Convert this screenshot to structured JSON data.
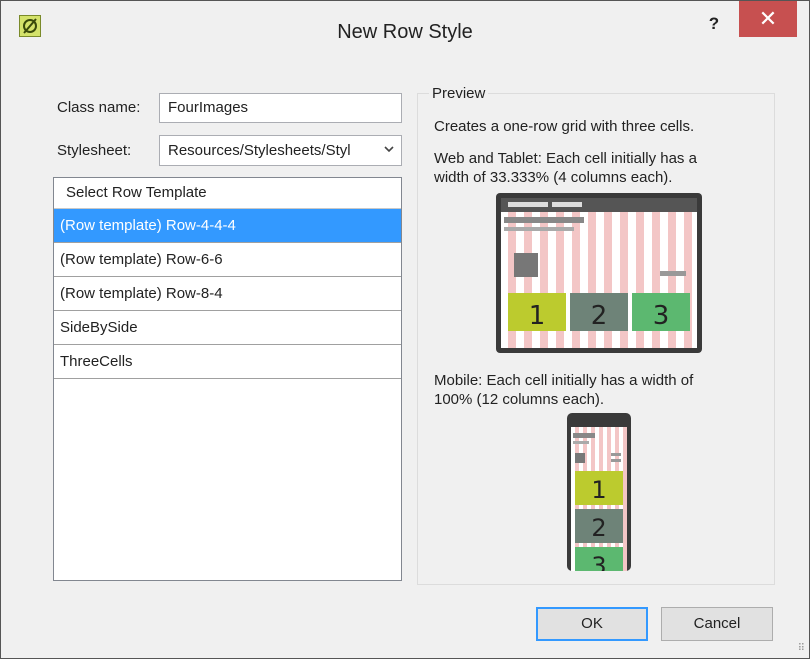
{
  "window": {
    "title": "New Row Style",
    "help_label": "?",
    "close_label": "✕",
    "app_icon": "leaf-slash-icon"
  },
  "form": {
    "class_name_label": "Class name:",
    "class_name_value": "FourImages",
    "stylesheet_label": "Stylesheet:",
    "stylesheet_value": "Resources/Stylesheets/Styl"
  },
  "templates": {
    "header": "Select Row Template",
    "items": [
      {
        "label": "(Row template) Row-4-4-4",
        "selected": true
      },
      {
        "label": "(Row template) Row-6-6",
        "selected": false
      },
      {
        "label": "(Row template) Row-8-4",
        "selected": false
      },
      {
        "label": "SideBySide",
        "selected": false
      },
      {
        "label": "ThreeCells",
        "selected": false
      }
    ]
  },
  "preview": {
    "legend": "Preview",
    "description": "Creates a one-row grid with three cells.",
    "web_line1": "Web and Tablet: Each cell initially has a",
    "web_line2": "width of 33.333% (4 columns each).",
    "mobile_line1": "Mobile: Each cell initially has a width of",
    "mobile_line2": "100% (12 columns each).",
    "cells": [
      "1",
      "2",
      "3"
    ],
    "colors": {
      "cell1": "#bccb2e",
      "cell2": "#6e8378",
      "cell3": "#5cb870",
      "grid_stripe": "#f3c6c6",
      "frame": "#3a3a3a"
    }
  },
  "buttons": {
    "ok": "OK",
    "cancel": "Cancel"
  },
  "colors": {
    "selection": "#3399ff",
    "close_red": "#c75050"
  }
}
